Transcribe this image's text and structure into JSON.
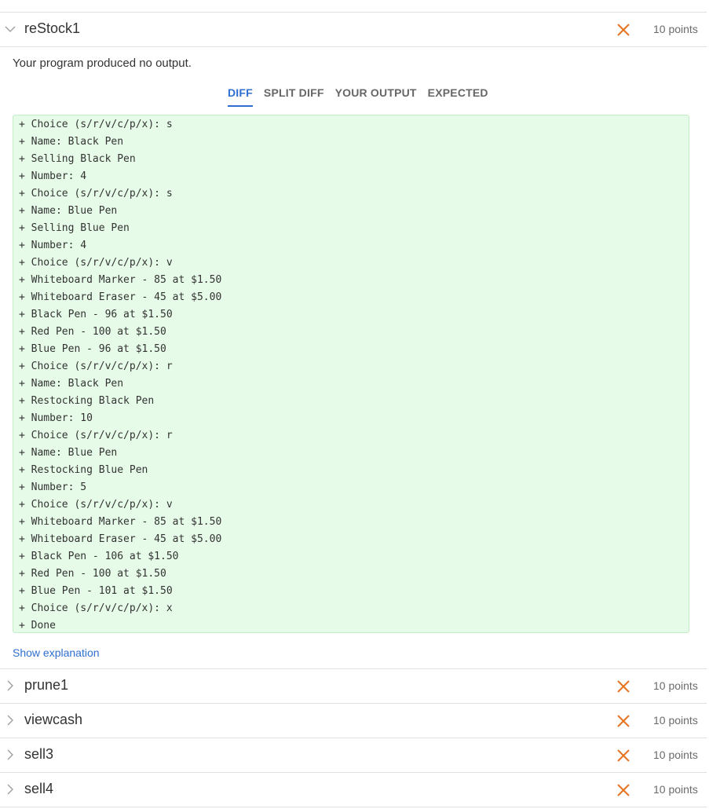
{
  "open_section": {
    "name": "reStock1",
    "points": "10 points",
    "status_icon": "x-icon",
    "message": "Your program produced no output.",
    "tabs": [
      "DIFF",
      "SPLIT DIFF",
      "YOUR OUTPUT",
      "EXPECTED"
    ],
    "active_tab": "DIFF",
    "diff_lines": [
      "+ Choice (s/r/v/c/p/x): s",
      "+ Name: Black Pen",
      "+ Selling Black Pen",
      "+ Number: 4",
      "+ Choice (s/r/v/c/p/x): s",
      "+ Name: Blue Pen",
      "+ Selling Blue Pen",
      "+ Number: 4",
      "+ Choice (s/r/v/c/p/x): v",
      "+ Whiteboard Marker - 85 at $1.50",
      "+ Whiteboard Eraser - 45 at $5.00",
      "+ Black Pen - 96 at $1.50",
      "+ Red Pen - 100 at $1.50",
      "+ Blue Pen - 96 at $1.50",
      "+ Choice (s/r/v/c/p/x): r",
      "+ Name: Black Pen",
      "+ Restocking Black Pen",
      "+ Number: 10",
      "+ Choice (s/r/v/c/p/x): r",
      "+ Name: Blue Pen",
      "+ Restocking Blue Pen",
      "+ Number: 5",
      "+ Choice (s/r/v/c/p/x): v",
      "+ Whiteboard Marker - 85 at $1.50",
      "+ Whiteboard Eraser - 45 at $5.00",
      "+ Black Pen - 106 at $1.50",
      "+ Red Pen - 100 at $1.50",
      "+ Blue Pen - 101 at $1.50",
      "+ Choice (s/r/v/c/p/x): x",
      "+ Done"
    ],
    "explanation_link": "Show explanation"
  },
  "collapsed_sections": [
    {
      "name": "prune1",
      "points": "10 points"
    },
    {
      "name": "viewcash",
      "points": "10 points"
    },
    {
      "name": "sell3",
      "points": "10 points"
    },
    {
      "name": "sell4",
      "points": "10 points"
    }
  ],
  "colors": {
    "accent": "#2f6fd0",
    "fail": "#e8731e",
    "diff_bg": "#e6fbe8"
  }
}
